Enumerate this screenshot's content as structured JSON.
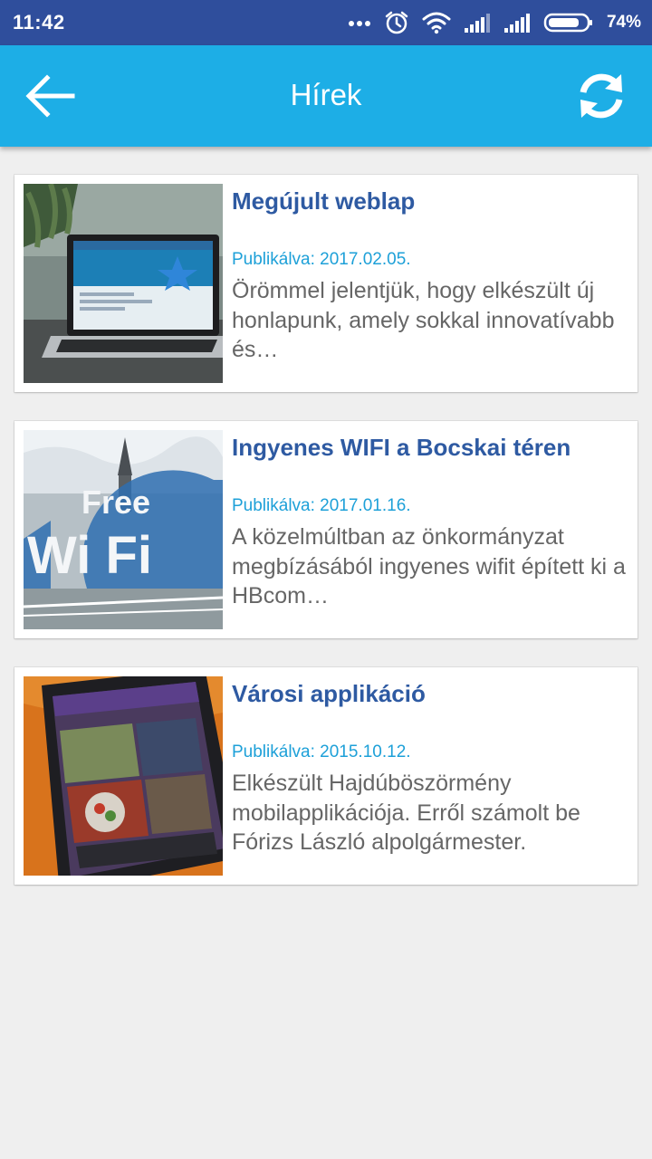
{
  "status_bar": {
    "time": "11:42",
    "battery_percent": "74%",
    "icons": [
      "more-dots-icon",
      "alarm-icon",
      "wifi-icon",
      "signal-icon",
      "signal-icon",
      "battery-icon"
    ]
  },
  "app_bar": {
    "title": "Hírek",
    "back_icon": "back-arrow-icon",
    "refresh_icon": "refresh-icon"
  },
  "news": [
    {
      "title": "Megújult weblap",
      "date": "Publikálva: 2017.02.05.",
      "excerpt": "Örömmel jelentjük, hogy elkészült új honlapunk, amely sokkal innovatívabb és…",
      "image": "laptop-website-image"
    },
    {
      "title": "Ingyenes WIFI a Bocskai téren",
      "date": "Publikálva: 2017.01.16.",
      "excerpt": "A közelmúltban az önkormányzat megbízásából ingyenes wifit épített ki a HBcom…",
      "image": "free-wifi-image",
      "image_text": "Free Wi Fi"
    },
    {
      "title": "Városi applikáció",
      "date": "Publikálva: 2015.10.12.",
      "excerpt": "Elkészült Hajdúböszörmény mobilapplikációja. Erről számolt be Fórizs László alpolgármester.",
      "image": "smartphone-app-image"
    }
  ],
  "colors": {
    "status_bar": "#2f4e9c",
    "app_bar": "#1daee6",
    "title": "#2e5aa2",
    "date": "#1da0d8",
    "excerpt": "#666666",
    "background": "#efefef"
  }
}
